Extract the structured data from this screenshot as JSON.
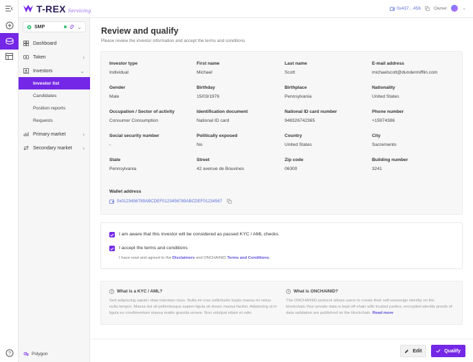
{
  "brand": {
    "name": "T-REX",
    "sub": "Servicing"
  },
  "topbar": {
    "address": "0x437…456",
    "role": "Owner"
  },
  "sidebar": {
    "selector": {
      "name": "SMP"
    },
    "items": [
      {
        "label": "Dashboard"
      },
      {
        "label": "Token"
      },
      {
        "label": "Investors"
      },
      {
        "label": "Primary market"
      },
      {
        "label": "Secondary market"
      }
    ],
    "sub_items": [
      {
        "label": "Investor list"
      },
      {
        "label": "Candidates"
      },
      {
        "label": "Position reports"
      },
      {
        "label": "Requests"
      }
    ],
    "network": "Polygon"
  },
  "page": {
    "title": "Review and qualify",
    "subtitle": "Please review the investor information and accept the terms and conditions"
  },
  "investor": {
    "fields": [
      {
        "label": "Investor type",
        "value": "Individual"
      },
      {
        "label": "First name",
        "value": "Michael"
      },
      {
        "label": "Last name",
        "value": "Scott"
      },
      {
        "label": "E-mail address",
        "value": "michaelscott@dundermifflin.com"
      },
      {
        "label": "Gender",
        "value": "Male"
      },
      {
        "label": "Birthday",
        "value": "15/03/1976"
      },
      {
        "label": "Birthplace",
        "value": "Pennsylvania"
      },
      {
        "label": "Nationality",
        "value": "United States"
      },
      {
        "label": "Occupation / Sector of activity",
        "value": "Consumer Consumption"
      },
      {
        "label": "Identification document",
        "value": "National ID card"
      },
      {
        "label": "National ID card number",
        "value": "948326742365"
      },
      {
        "label": "Phone number",
        "value": "+15974386"
      },
      {
        "label": "Social security number",
        "value": "-"
      },
      {
        "label": "Politically exposed",
        "value": "No"
      },
      {
        "label": "Country",
        "value": "United States"
      },
      {
        "label": "City",
        "value": "Sacremento"
      },
      {
        "label": "State",
        "value": "Pennsylvania"
      },
      {
        "label": "Street",
        "value": "42 avenue de Bouvines"
      },
      {
        "label": "Zip code",
        "value": "06300"
      },
      {
        "label": "Building number",
        "value": "3241"
      }
    ],
    "wallet_label": "Wallet address",
    "wallet": "0x0123456789ABCDEF0123456789ABCDEF01234567"
  },
  "checks": {
    "kyc": "I am aware that this investor will be considered as passed KYC / AML checks.",
    "terms": "I accept the terms and conditions",
    "agree_prefix": "I have read and agreed to the",
    "disclaimers": "Disclaimers",
    "agree_mid": "and ONCHAINID",
    "terms_link": "Terms and Conditions."
  },
  "faq": {
    "kyc_q": "What is a KYC / AML?",
    "kyc_a": "Sed adipiscing sapien vitae interdum risus. Nulla mi cras sollicitudin turpis massa mi netus nulla tempor. Massa dui sit pellentesque sapien ligula sit donec massa facilisi. Adipiscing ut in ligula eu condimentum massa mattis gravida ornare. Non volutpat etiam et odio",
    "onchain_q": "What is ONCHAINID?",
    "onchain_a": "The ONCHAINID protocol allows users to create their self-sovereign identity on the blockchain.Your private data is kept off-chain with trusted parties, encrypted identity proofs of data validation are published on the blockchain.",
    "read_more": "Read more"
  },
  "actions": {
    "edit": "Edit",
    "qualify": "Qualify"
  },
  "colors": {
    "accent": "#7427e6",
    "link": "#5b6fd8",
    "status": "#2fbf71"
  }
}
